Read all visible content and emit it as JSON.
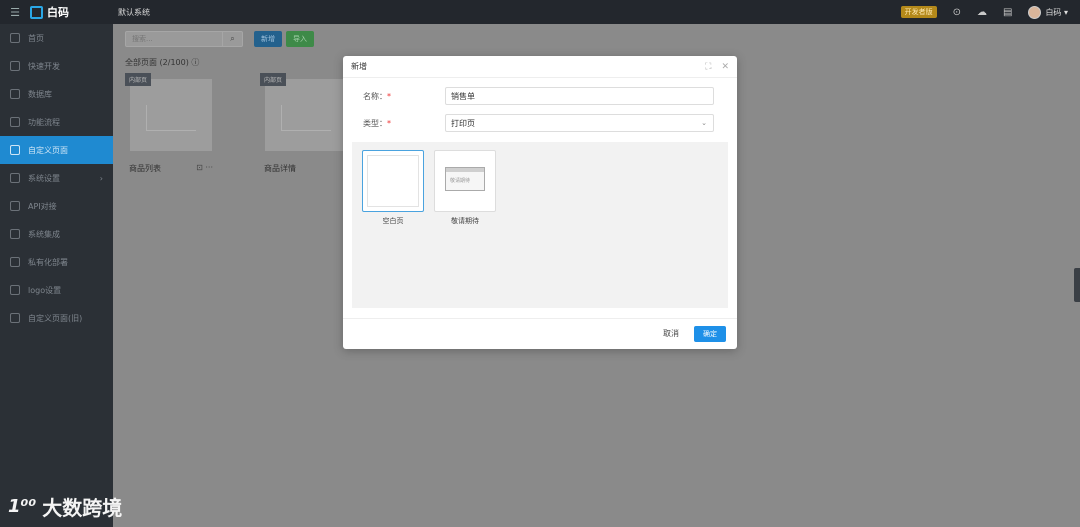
{
  "topbar": {
    "logo_text": "白码",
    "system_name": "默认系统",
    "badge": "开发者版",
    "user_name": "白码 ▾"
  },
  "sidebar": {
    "items": [
      {
        "label": "首页"
      },
      {
        "label": "快速开发"
      },
      {
        "label": "数据库"
      },
      {
        "label": "功能流程"
      },
      {
        "label": "自定义页面"
      },
      {
        "label": "系统设置",
        "arrow": "›"
      },
      {
        "label": "API对接"
      },
      {
        "label": "系统集成"
      },
      {
        "label": "私有化部署"
      },
      {
        "label": "logo设置"
      },
      {
        "label": "自定义页面(旧)"
      }
    ]
  },
  "main": {
    "search_placeholder": "搜索...",
    "new_label": "新增",
    "import_label": "导入",
    "all_pages": "全部页面 (2/100) ⓘ",
    "cards": [
      {
        "tag": "内部页",
        "label": "商品列表",
        "more": "⊡ ···"
      },
      {
        "tag": "内部页",
        "label": "商品详情"
      }
    ]
  },
  "dialog": {
    "title": "新增",
    "name_label": "名称：",
    "name_value": "销售单",
    "type_label": "类型：",
    "type_value": "打印页",
    "required_mark": "*",
    "templates": [
      {
        "label": "空白页",
        "selected": true
      },
      {
        "label": "敬请期待",
        "screen_text": "敬请期待"
      }
    ],
    "cancel_label": "取消",
    "ok_label": "确定"
  },
  "watermark": {
    "mark": "1⁰⁰",
    "text": "大数跨境"
  }
}
